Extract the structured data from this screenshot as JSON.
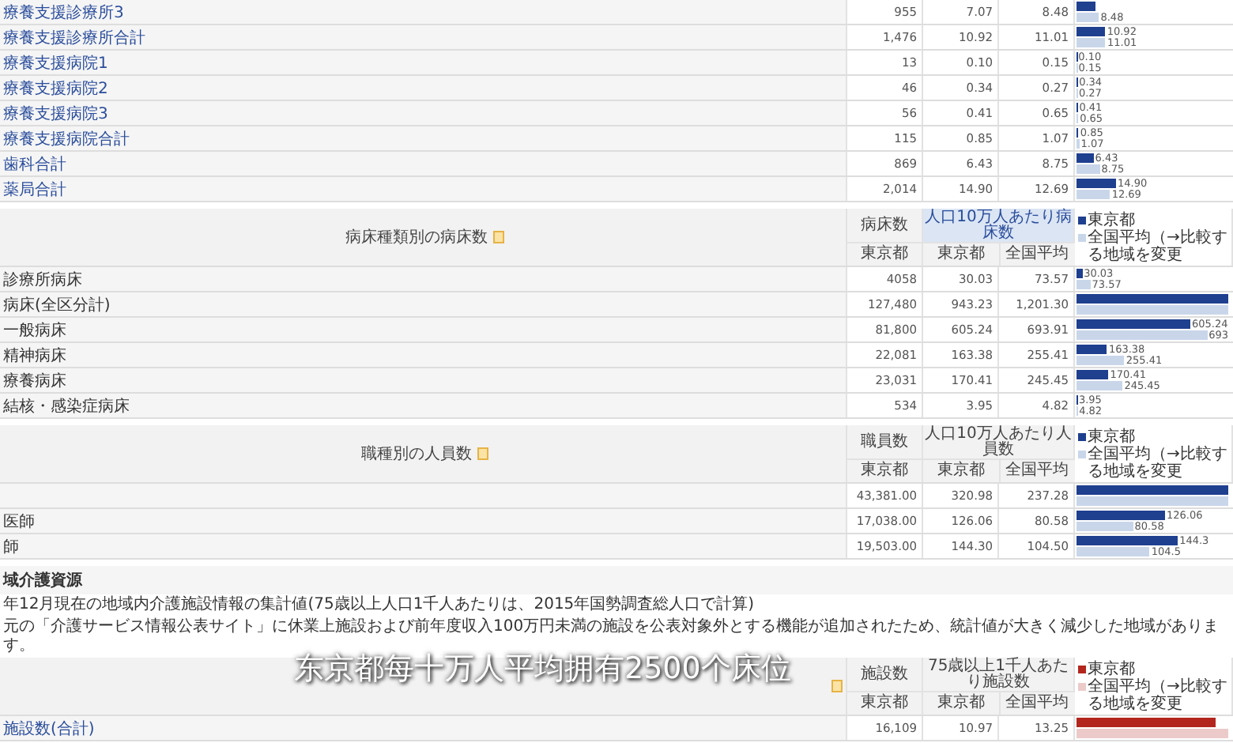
{
  "facility_rows": [
    {
      "label": "療養支援診療所3",
      "count": "955",
      "per_100k_tokyo": "7.07",
      "per_100k_national": "8.48",
      "bar_labels": [
        "8.48"
      ]
    },
    {
      "label": "療養支援診療所合計",
      "count": "1,476",
      "per_100k_tokyo": "10.92",
      "per_100k_national": "11.01",
      "bar_labels": [
        "10.92",
        "11.01"
      ]
    },
    {
      "label": "療養支援病院1",
      "count": "13",
      "per_100k_tokyo": "0.10",
      "per_100k_national": "0.15",
      "bar_labels": [
        "0.10",
        "0.15"
      ]
    },
    {
      "label": "療養支援病院2",
      "count": "46",
      "per_100k_tokyo": "0.34",
      "per_100k_national": "0.27",
      "bar_labels": [
        "0.34",
        "0.27"
      ]
    },
    {
      "label": "療養支援病院3",
      "count": "56",
      "per_100k_tokyo": "0.41",
      "per_100k_national": "0.65",
      "bar_labels": [
        "0.41",
        "0.65"
      ]
    },
    {
      "label": "療養支援病院合計",
      "count": "115",
      "per_100k_tokyo": "0.85",
      "per_100k_national": "1.07",
      "bar_labels": [
        "0.85",
        "1.07"
      ]
    },
    {
      "label": "歯科合計",
      "count": "869",
      "per_100k_tokyo": "6.43",
      "per_100k_national": "8.75",
      "bar_labels": [
        "6.43",
        "8.75"
      ]
    },
    {
      "label": "薬局合計",
      "count": "2,014",
      "per_100k_tokyo": "14.90",
      "per_100k_national": "12.69",
      "bar_labels": [
        "14.90",
        "12.69"
      ]
    }
  ],
  "bed_table": {
    "title": "病床種類別の病床数",
    "count_header": "病床数",
    "rate_header": "人口10万人あたり病床数",
    "sub_headers": [
      "東京都",
      "東京都",
      "全国平均"
    ],
    "legend": [
      {
        "label": "東京都",
        "color": "#1f3f8f"
      },
      {
        "label": "全国平均（→比較する地域を変更",
        "color": "#c9d6ea"
      }
    ],
    "rows": [
      {
        "label": "診療所病床",
        "count": "4058",
        "per_100k_tokyo": "30.03",
        "per_100k_national": "73.57",
        "bar_labels": [
          "30.03",
          "73.57"
        ]
      },
      {
        "label": "病床(全区分計)",
        "count": "127,480",
        "per_100k_tokyo": "943.23",
        "per_100k_national": "1,201.30"
      },
      {
        "label": "一般病床",
        "count": "81,800",
        "per_100k_tokyo": "605.24",
        "per_100k_national": "693.91",
        "bar_labels": [
          "605.24",
          "693"
        ]
      },
      {
        "label": "精神病床",
        "count": "22,081",
        "per_100k_tokyo": "163.38",
        "per_100k_national": "255.41",
        "bar_labels": [
          "163.38",
          "255.41"
        ]
      },
      {
        "label": "療養病床",
        "count": "23,031",
        "per_100k_tokyo": "170.41",
        "per_100k_national": "245.45",
        "bar_labels": [
          "170.41",
          "245.45"
        ]
      },
      {
        "label": "結核・感染症病床",
        "count": "534",
        "per_100k_tokyo": "3.95",
        "per_100k_national": "4.82",
        "bar_labels": [
          "3.95",
          "4.82"
        ]
      }
    ]
  },
  "staff_table": {
    "title": "職種別の人員数",
    "count_header": "職員数",
    "rate_header": "人口10万人あたり人員数",
    "sub_headers": [
      "東京都",
      "東京都",
      "全国平均"
    ],
    "legend": [
      {
        "label": "東京都",
        "color": "#1f3f8f"
      },
      {
        "label": "全国平均（→比較する地域を変更",
        "color": "#c9d6ea"
      }
    ],
    "rows": [
      {
        "label": "",
        "count": "43,381.00",
        "per_100k_tokyo": "320.98",
        "per_100k_national": "237.28"
      },
      {
        "label": "医師",
        "count": "17,038.00",
        "per_100k_tokyo": "126.06",
        "per_100k_national": "80.58",
        "bar_labels": [
          "126.06",
          "80.58"
        ]
      },
      {
        "label": "師",
        "count": "19,503.00",
        "per_100k_tokyo": "144.30",
        "per_100k_national": "104.50",
        "bar_labels": [
          "144.3",
          "104.5"
        ]
      }
    ]
  },
  "care_section": {
    "title": "域介護資源",
    "notes": [
      "年12月現在の地域内介護施設情報の集計値(75歳以上人口1千人あたりは、2015年国勢調査総人口で計算)",
      "元の「介護サービス情報公表サイト」に休業上施設および前年度収入100万円未満の施設を公表対象外とする機能が追加されたため、統計値が大きく減少した地域があります。"
    ]
  },
  "care_table": {
    "count_header": "施設数",
    "rate_header": "75歳以上1千人あたり施設数",
    "sub_headers": [
      "東京都",
      "東京都",
      "全国平均"
    ],
    "legend": [
      {
        "label": "東京都",
        "color": "#b3261e"
      },
      {
        "label": "全国平均（→比較する地域を変更",
        "color": "#eccaca"
      }
    ],
    "rows": [
      {
        "label": "施設数(合計)",
        "count": "16,109",
        "per_100k_tokyo": "10.97",
        "per_100k_national": "13.25"
      }
    ]
  },
  "subtitle": "东京都每十万人平均拥有2500个床位"
}
